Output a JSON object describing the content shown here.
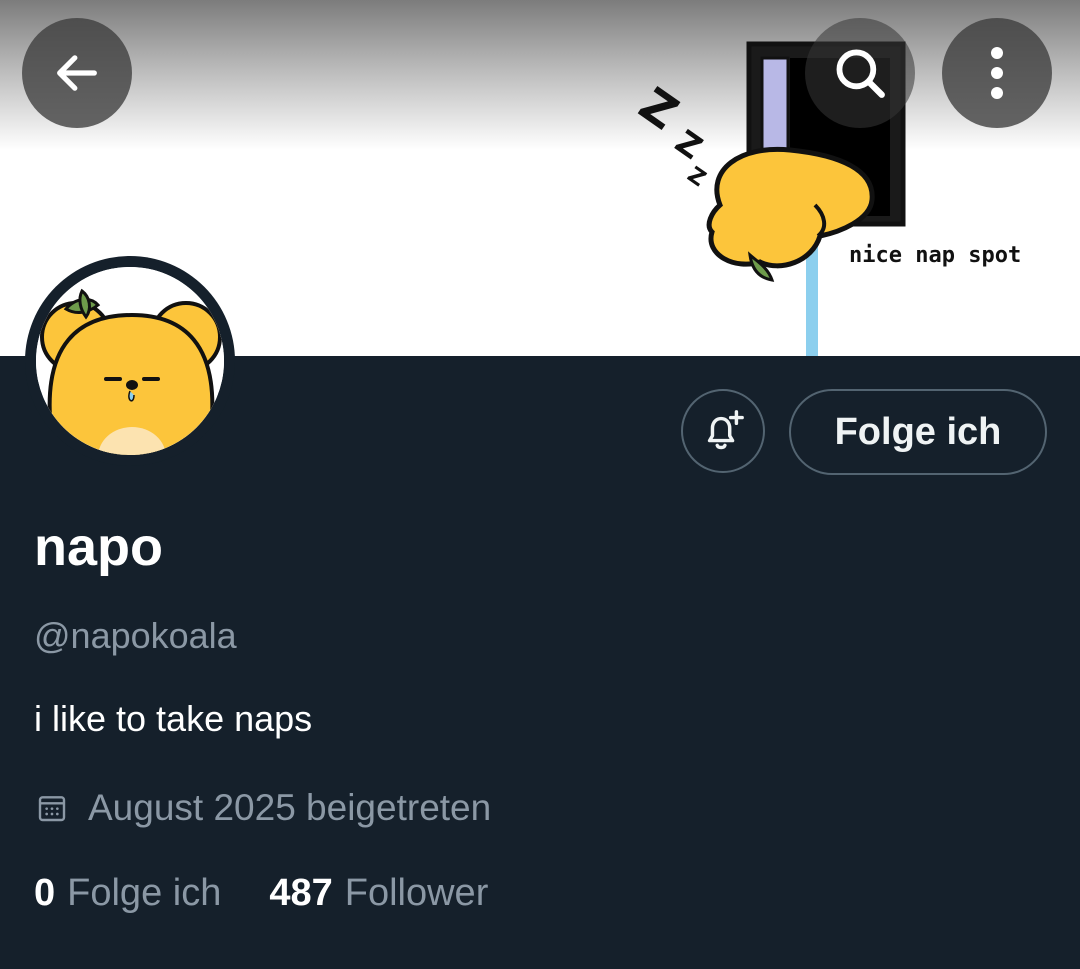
{
  "header": {
    "back_icon": "arrow-left-icon",
    "search_icon": "search-icon",
    "more_icon": "more-vertical-icon"
  },
  "banner": {
    "caption": "nice nap spot",
    "sleep_text": "ZZZ"
  },
  "profile": {
    "display_name": "napo",
    "handle": "@napokoala",
    "bio": "i like to take naps",
    "joined": "August 2025 beigetreten",
    "follow_button_label": "Folge ich",
    "notify_icon": "bell-plus-icon"
  },
  "stats": {
    "following_count": "0",
    "following_label": "Folge ich",
    "followers_count": "487",
    "followers_label": "Follower"
  },
  "colors": {
    "background": "#15202b",
    "secondary_text": "#8b98a5",
    "border": "#536471",
    "mascot": "#fcc53b"
  }
}
